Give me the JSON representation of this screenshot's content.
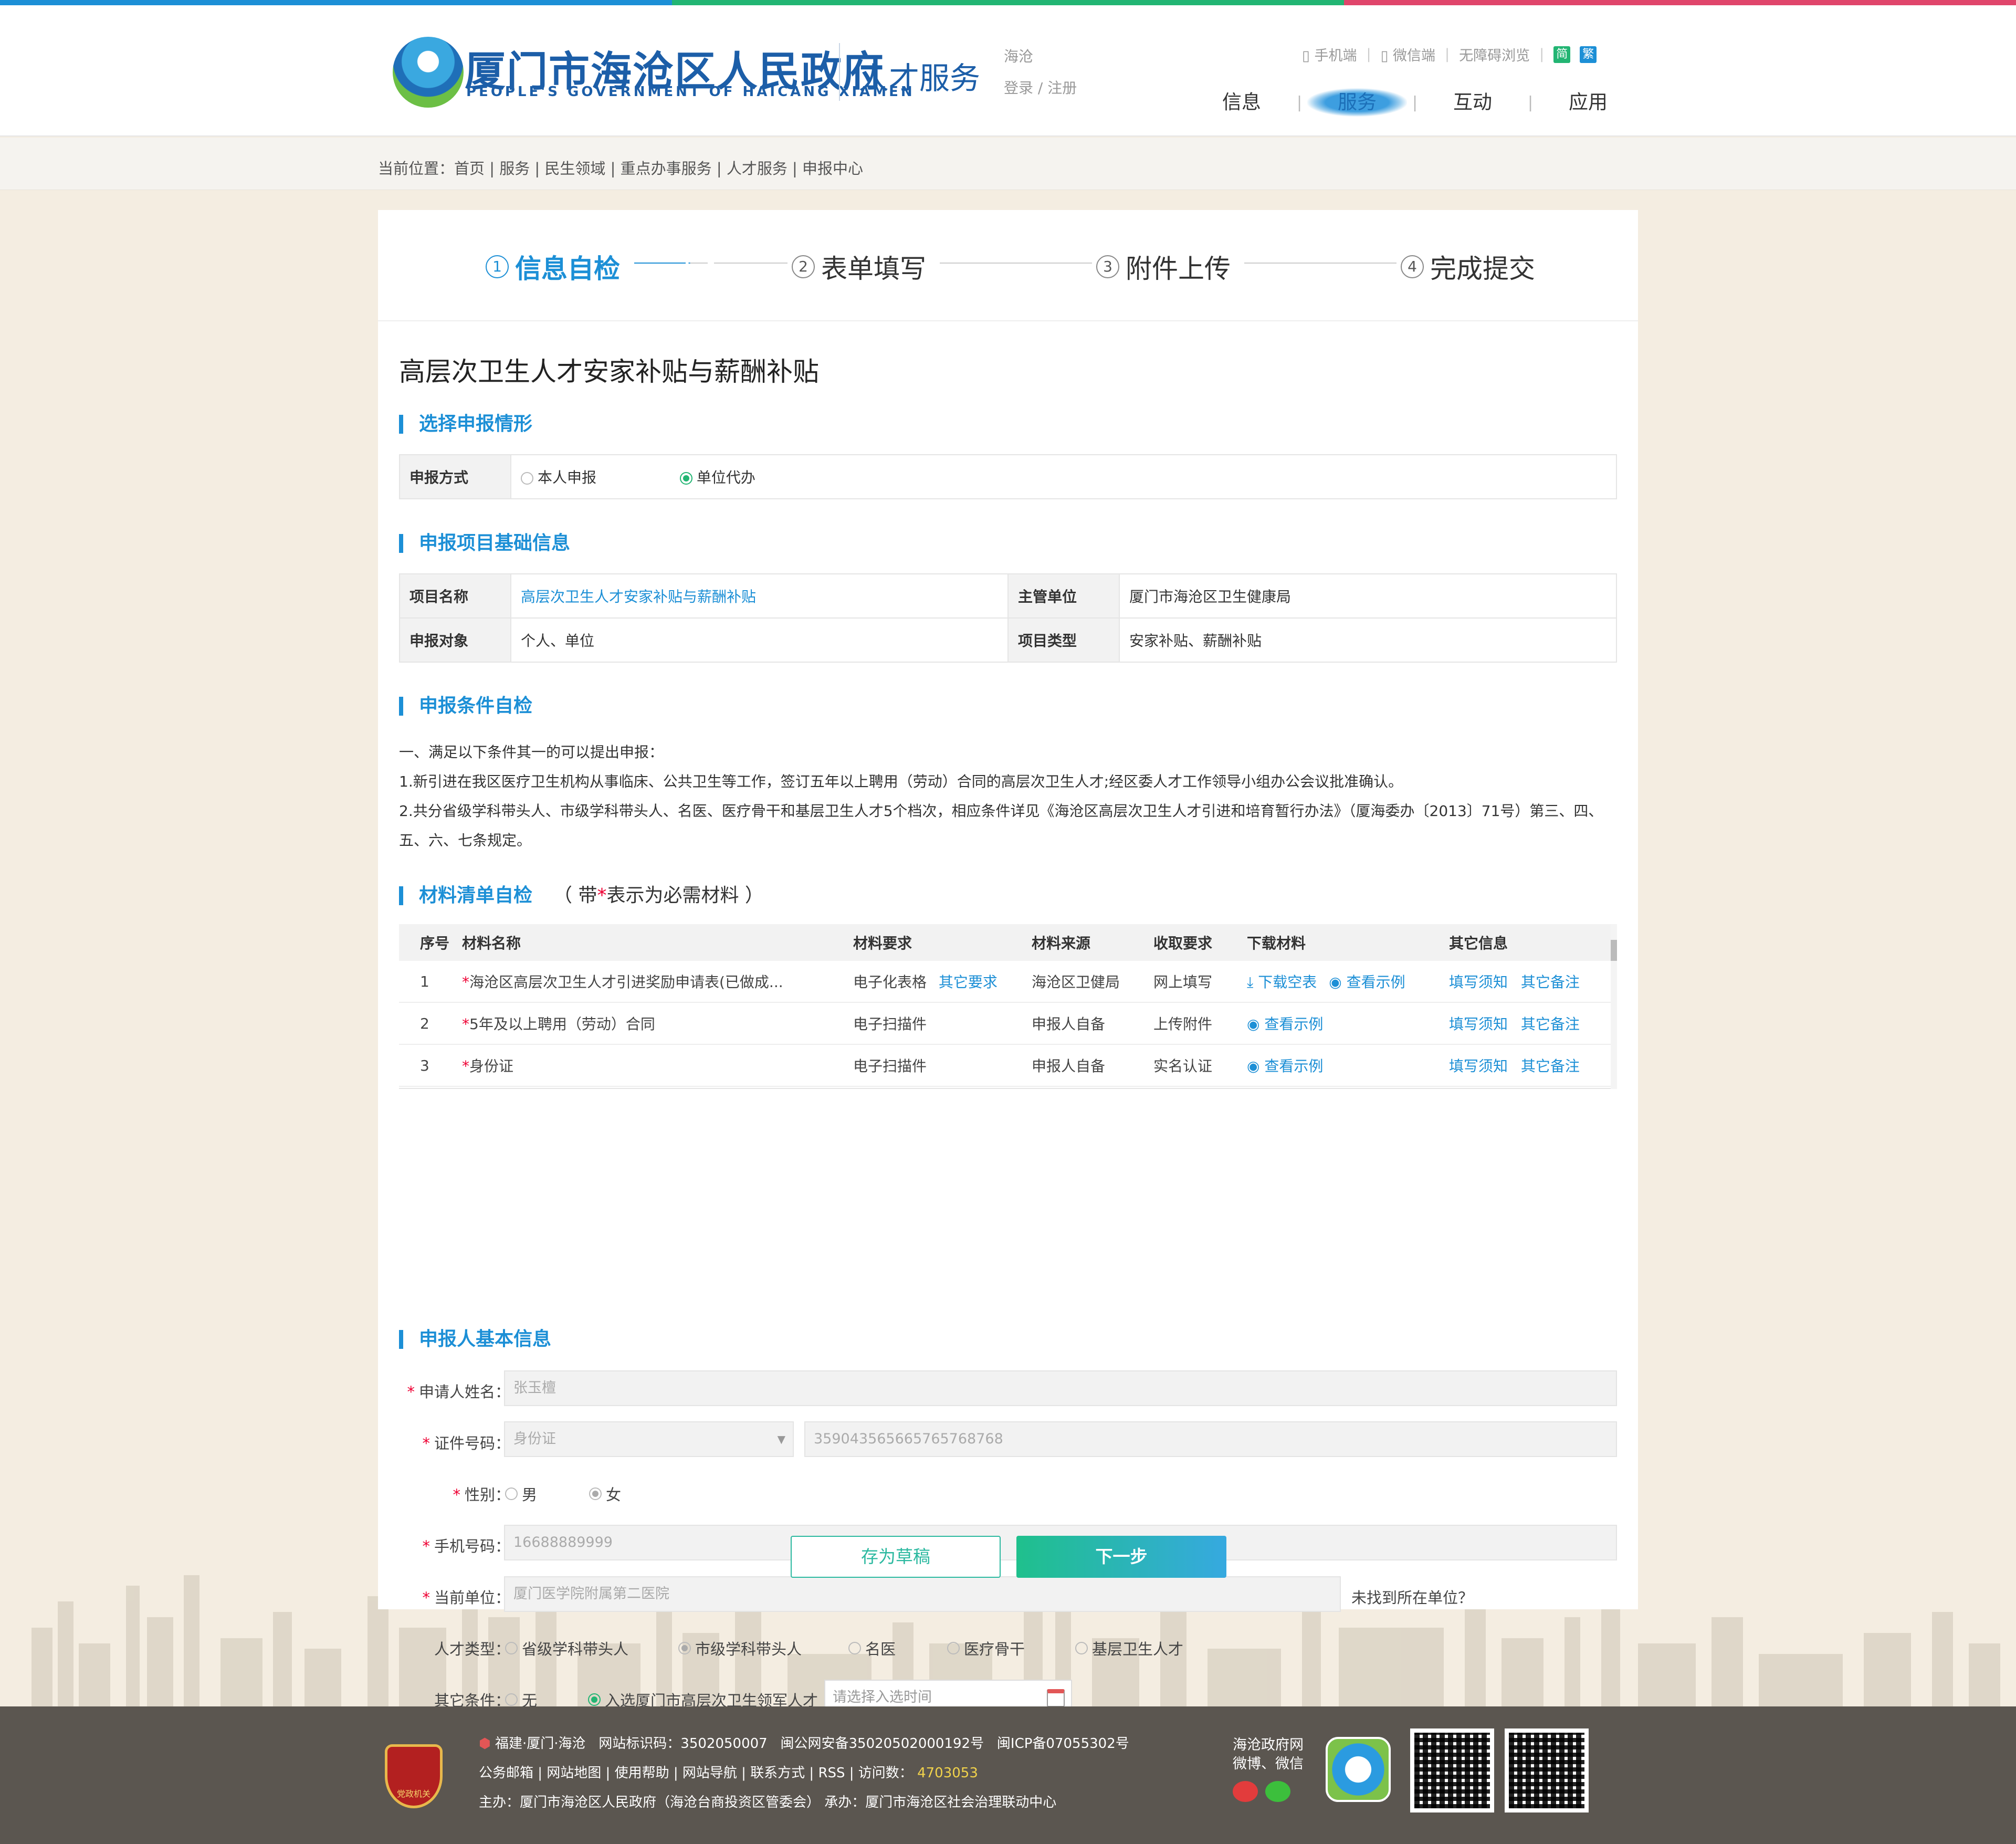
{
  "colors": {
    "brand_blue": "#1c8fd6",
    "gov_blue": "#1c5ea8",
    "green": "#22b573",
    "footer_bg": "#5b5650",
    "page_bg": "#f4ede1",
    "topbar": [
      "#1c8fd6",
      "#22b573",
      "#e0456b"
    ]
  },
  "header": {
    "title": "厦门市海沧区人民政府",
    "subtitle": "PEOPLE'S GOVERNMENT OF HAICANG XIAMEN",
    "section": "人才服务",
    "region": "海沧",
    "login": "登录 / 注册",
    "toplinks": [
      {
        "label": "手机端",
        "icon": "mobile-icon"
      },
      {
        "label": "微信端",
        "icon": "wechat-small-icon"
      },
      {
        "label": "无障碍浏览",
        "icon": ""
      }
    ],
    "lang_simple": "简",
    "lang_trad": "繁",
    "nav": [
      "信息",
      "服务",
      "互动",
      "应用"
    ],
    "nav_active": "服务"
  },
  "breadcrumb": "当前位置：首页 | 服务 | 民生领域 | 重点办事服务 | 人才服务 | 申报中心",
  "steps": [
    {
      "num": "1",
      "label": "信息自检",
      "active": true
    },
    {
      "num": "2",
      "label": "表单填写",
      "active": false
    },
    {
      "num": "3",
      "label": "附件上传",
      "active": false
    },
    {
      "num": "4",
      "label": "完成提交",
      "active": false
    }
  ],
  "page_title": "高层次卫生人才安家补贴与薪酬补贴",
  "sections": {
    "scenario": "选择申报情形",
    "basic": "申报项目基础信息",
    "conditions": "申报条件自检",
    "materials": "材料清单自检",
    "materials_note_pre": "（ 带",
    "materials_note_star": "*",
    "materials_note_post": "表示为必需材料 ）",
    "applicant": "申报人基本信息"
  },
  "scenario": {
    "label": "申报方式",
    "options": [
      "本人申报",
      "单位代办"
    ],
    "selected": "单位代办"
  },
  "basic_info": {
    "project_name_label": "项目名称",
    "project_name": "高层次卫生人才安家补贴与薪酬补贴",
    "dept_label": "主管单位",
    "dept": "厦门市海沧区卫生健康局",
    "target_label": "申报对象",
    "target": "个人、单位",
    "type_label": "项目类型",
    "type": "安家补贴、薪酬补贴"
  },
  "conditions": [
    "一、满足以下条件其一的可以提出申报：",
    "1.新引进在我区医疗卫生机构从事临床、公共卫生等工作，签订五年以上聘用（劳动）合同的高层次卫生人才;经区委人才工作领导小组办公会议批准确认。",
    "2.共分省级学科带头人、市级学科带头人、名医、医疗骨干和基层卫生人才5个档次，相应条件详见《海沧区高层次卫生人才引进和培育暂行办法》（厦海委办〔2013〕71号）第三、四、",
    "五、六、七条规定。"
  ],
  "materials": {
    "headers": [
      "序号",
      "材料名称",
      "材料要求",
      "材料来源",
      "收取要求",
      "下载材料",
      "其它信息"
    ],
    "rows": [
      {
        "no": "1",
        "name": "海沧区高层次卫生人才引进奖励申请表(已做成...",
        "req": "电子化表格",
        "req_link": "其它要求",
        "source": "海沧区卫健局",
        "collect": "网上填写",
        "download": "下载空表",
        "example": "查看示例",
        "info1": "填写须知",
        "info2": "其它备注"
      },
      {
        "no": "2",
        "name": "5年及以上聘用（劳动）合同",
        "req": "电子扫描件",
        "req_link": "",
        "source": "申报人自备",
        "collect": "上传附件",
        "download": "",
        "example": "查看示例",
        "info1": "填写须知",
        "info2": "其它备注"
      },
      {
        "no": "3",
        "name": "身份证",
        "req": "电子扫描件",
        "req_link": "",
        "source": "申报人自备",
        "collect": "实名认证",
        "download": "",
        "example": "查看示例",
        "info1": "填写须知",
        "info2": "其它备注"
      }
    ]
  },
  "applicant": {
    "name_label": "申请人姓名：",
    "name": "张玉檀",
    "id_label": "证件号码：",
    "id_type": "身份证",
    "id_number": "359043565665765768768",
    "gender_label": "性别：",
    "genders": [
      "男",
      "女"
    ],
    "gender_selected": "女",
    "phone_label": "手机号码：",
    "phone": "16688889999",
    "unit_label": "当前单位：",
    "unit": "厦门医学院附属第二医院",
    "unit_link": "未找到所在单位？",
    "talent_label": "人才类型：",
    "talent_types": [
      "省级学科带头人",
      "市级学科带头人",
      "名医",
      "医疗骨干",
      "基层卫生人才"
    ],
    "talent_selected": "市级学科带头人",
    "other_label": "其它条件：",
    "other_options": [
      "无",
      "入选厦门市高层次卫生领军人才"
    ],
    "other_selected": "入选厦门市高层次卫生领军人才",
    "date_placeholder": "请选择入选时间"
  },
  "buttons": {
    "draft": "存为草稿",
    "next": "下一步"
  },
  "footer": {
    "emblem_text": "党政机关",
    "line1_a": "福建·厦门·海沧",
    "line1_b": "网站标识码：3502050007",
    "line1_c": "闽公网安备35020502000192号",
    "line1_d": "闽ICP备07055302号",
    "line2": "公务邮箱 | 网站地图 | 使用帮助 | 网站导航 | 联系方式 | RSS | 访问数：",
    "visits": "4703053",
    "line3": "主办：厦门市海沧区人民政府（海沧台商投资区管委会） 承办：厦门市海沧区社会治理联动中心",
    "social1": "海沧政府网",
    "social2": "微博、微信"
  }
}
